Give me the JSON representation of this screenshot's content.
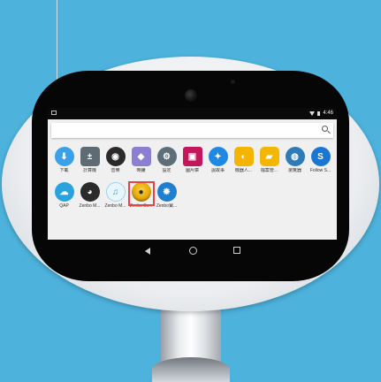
{
  "status_bar": {
    "time": "4:46"
  },
  "apps": [
    {
      "label": "下載",
      "icon": "download-icon",
      "color": "#3aa0e8",
      "glyph": "⬇"
    },
    {
      "label": "計算機",
      "icon": "calculator-icon",
      "color": "#5f6b73",
      "glyph": "±"
    },
    {
      "label": "音樂",
      "icon": "music-disc-icon",
      "color": "#2a2a2a",
      "glyph": "◉"
    },
    {
      "label": "時鐘",
      "icon": "cube-icon",
      "color": "#8b7fd4",
      "glyph": "◆"
    },
    {
      "label": "設定",
      "icon": "gear-icon",
      "color": "#5c6e78",
      "glyph": "⚙"
    },
    {
      "label": "圖片庫",
      "icon": "gallery-icon",
      "color": "#c2185b",
      "glyph": "▣"
    },
    {
      "label": "說故事",
      "icon": "storybook-icon",
      "color": "#1e88e5",
      "glyph": "✦"
    },
    {
      "label": "機器人...",
      "icon": "robot-app-icon",
      "color": "#f5b400",
      "glyph": "◐"
    },
    {
      "label": "檔案管...",
      "icon": "folder-icon",
      "color": "#f2b705",
      "glyph": "▰"
    },
    {
      "label": "瀏覽器",
      "icon": "browser-globe-icon",
      "color": "#2e7bb8",
      "glyph": "◍"
    },
    {
      "label": "Follow S...",
      "icon": "follow-s-icon",
      "color": "#1976d2",
      "glyph": "S"
    },
    {
      "label": "QAP",
      "icon": "cloud-icon",
      "color": "#29a3e0",
      "glyph": "☁"
    },
    {
      "label": "Zenbo M...",
      "icon": "zenbo-face-icon",
      "color": "#2b2b2b",
      "glyph": "◕"
    },
    {
      "label": "Zenbo M...",
      "icon": "music-note-icon",
      "color": "#e8f5fb",
      "glyph": "♫"
    },
    {
      "label": "Zenbo Sc...",
      "icon": "zenbo-scene-icon",
      "color": "#f0c020",
      "glyph": "●"
    },
    {
      "label": "Zenbo寶...",
      "icon": "zenbo-treasure-icon",
      "color": "#1e7fd0",
      "glyph": "✹"
    }
  ]
}
